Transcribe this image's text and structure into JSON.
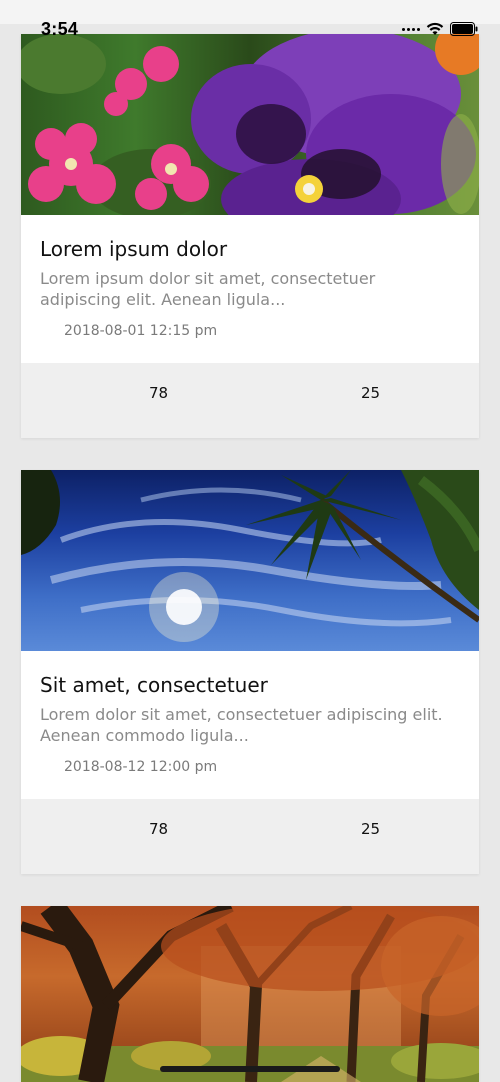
{
  "status_bar": {
    "time": "3:54"
  },
  "cards": [
    {
      "title": "Lorem ipsum dolor",
      "description": "Lorem ipsum dolor sit amet, consectetuer adipiscing elit. Aenean  ligula...",
      "date": "2018-08-01 12:15 pm",
      "stat_left": "78",
      "stat_right": "25",
      "image": "purple-pansy-and-pink-flowers"
    },
    {
      "title": "Sit amet, consectetuer",
      "description": "Lorem  dolor sit amet, consectetuer adipiscing elit. Aenean commodo ligula...",
      "date": "2018-08-12 12:00 pm",
      "stat_left": "78",
      "stat_right": "25",
      "image": "palm-trees-blue-sky-sun"
    },
    {
      "image": "autumn-trees-path"
    }
  ],
  "colors": {
    "background": "#e8e8e8",
    "card": "#ffffff",
    "card_footer": "#efefef",
    "title_text": "#111111",
    "description_text": "#8a8a8a",
    "date_text": "#7a7a7a"
  }
}
